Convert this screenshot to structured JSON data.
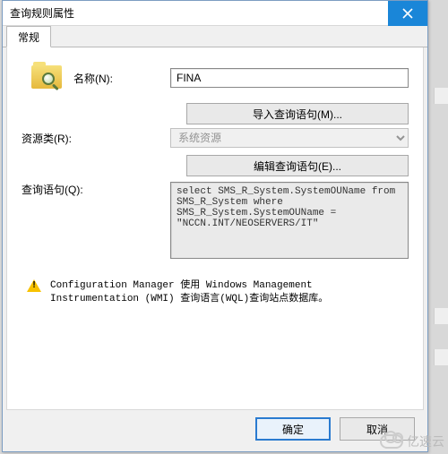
{
  "titlebar": {
    "title": "查询规则属性"
  },
  "tabs": {
    "general": "常规"
  },
  "labels": {
    "name": "名称(N):",
    "resource_class": "资源类(R):",
    "query": "查询语句(Q):"
  },
  "fields": {
    "name_value": "FINA",
    "resource_class_value": "系统资源",
    "query_value": "select SMS_R_System.SystemOUName from SMS_R_System where SMS_R_System.SystemOUName = \"NCCN.INT/NEOSERVERS/IT\""
  },
  "buttons": {
    "import": "导入查询语句(M)...",
    "edit": "编辑查询语句(E)...",
    "ok": "确定",
    "cancel": "取消"
  },
  "info": {
    "text": "Configuration Manager 使用 Windows Management Instrumentation (WMI) 查询语言(WQL)查询站点数据库。"
  },
  "watermark": "亿速云"
}
